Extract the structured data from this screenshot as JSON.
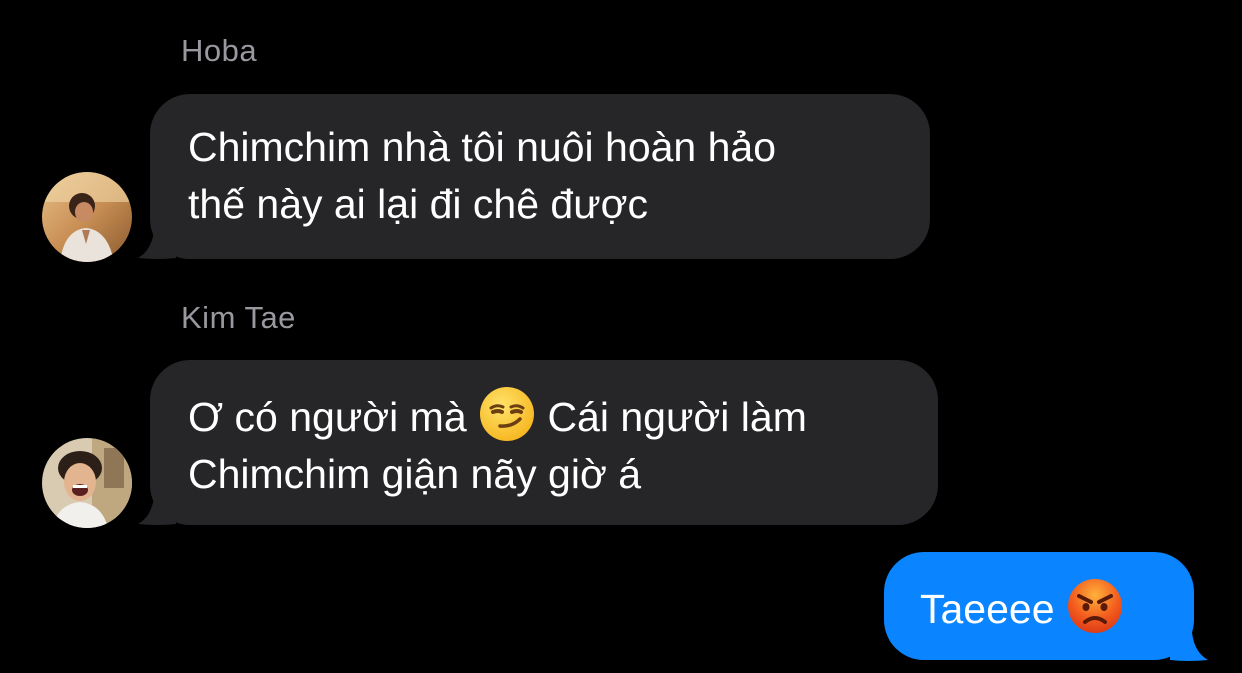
{
  "theme": {
    "background": "#000000",
    "incoming_bubble": "#262628",
    "outgoing_bubble": "#0b84ff",
    "name_color": "#98989e",
    "text_color": "#ffffff"
  },
  "messages": [
    {
      "sender": "Hoba",
      "direction": "incoming",
      "avatar": "person-photo-avatar",
      "lines": [
        "Chimchim nhà tôi nuôi hoàn hảo",
        "thế này ai lại đi chê được"
      ]
    },
    {
      "sender": "Kim Tae",
      "direction": "incoming",
      "avatar": "person-photo-avatar",
      "lines": [
        "Ơ có người mà",
        "Cái người làm",
        "Chimchim giận nãy giờ á"
      ],
      "emoji": "smirking-face-emoji"
    },
    {
      "direction": "outgoing",
      "lines": [
        "Taeeee"
      ],
      "emoji": "angry-face-emoji"
    }
  ]
}
